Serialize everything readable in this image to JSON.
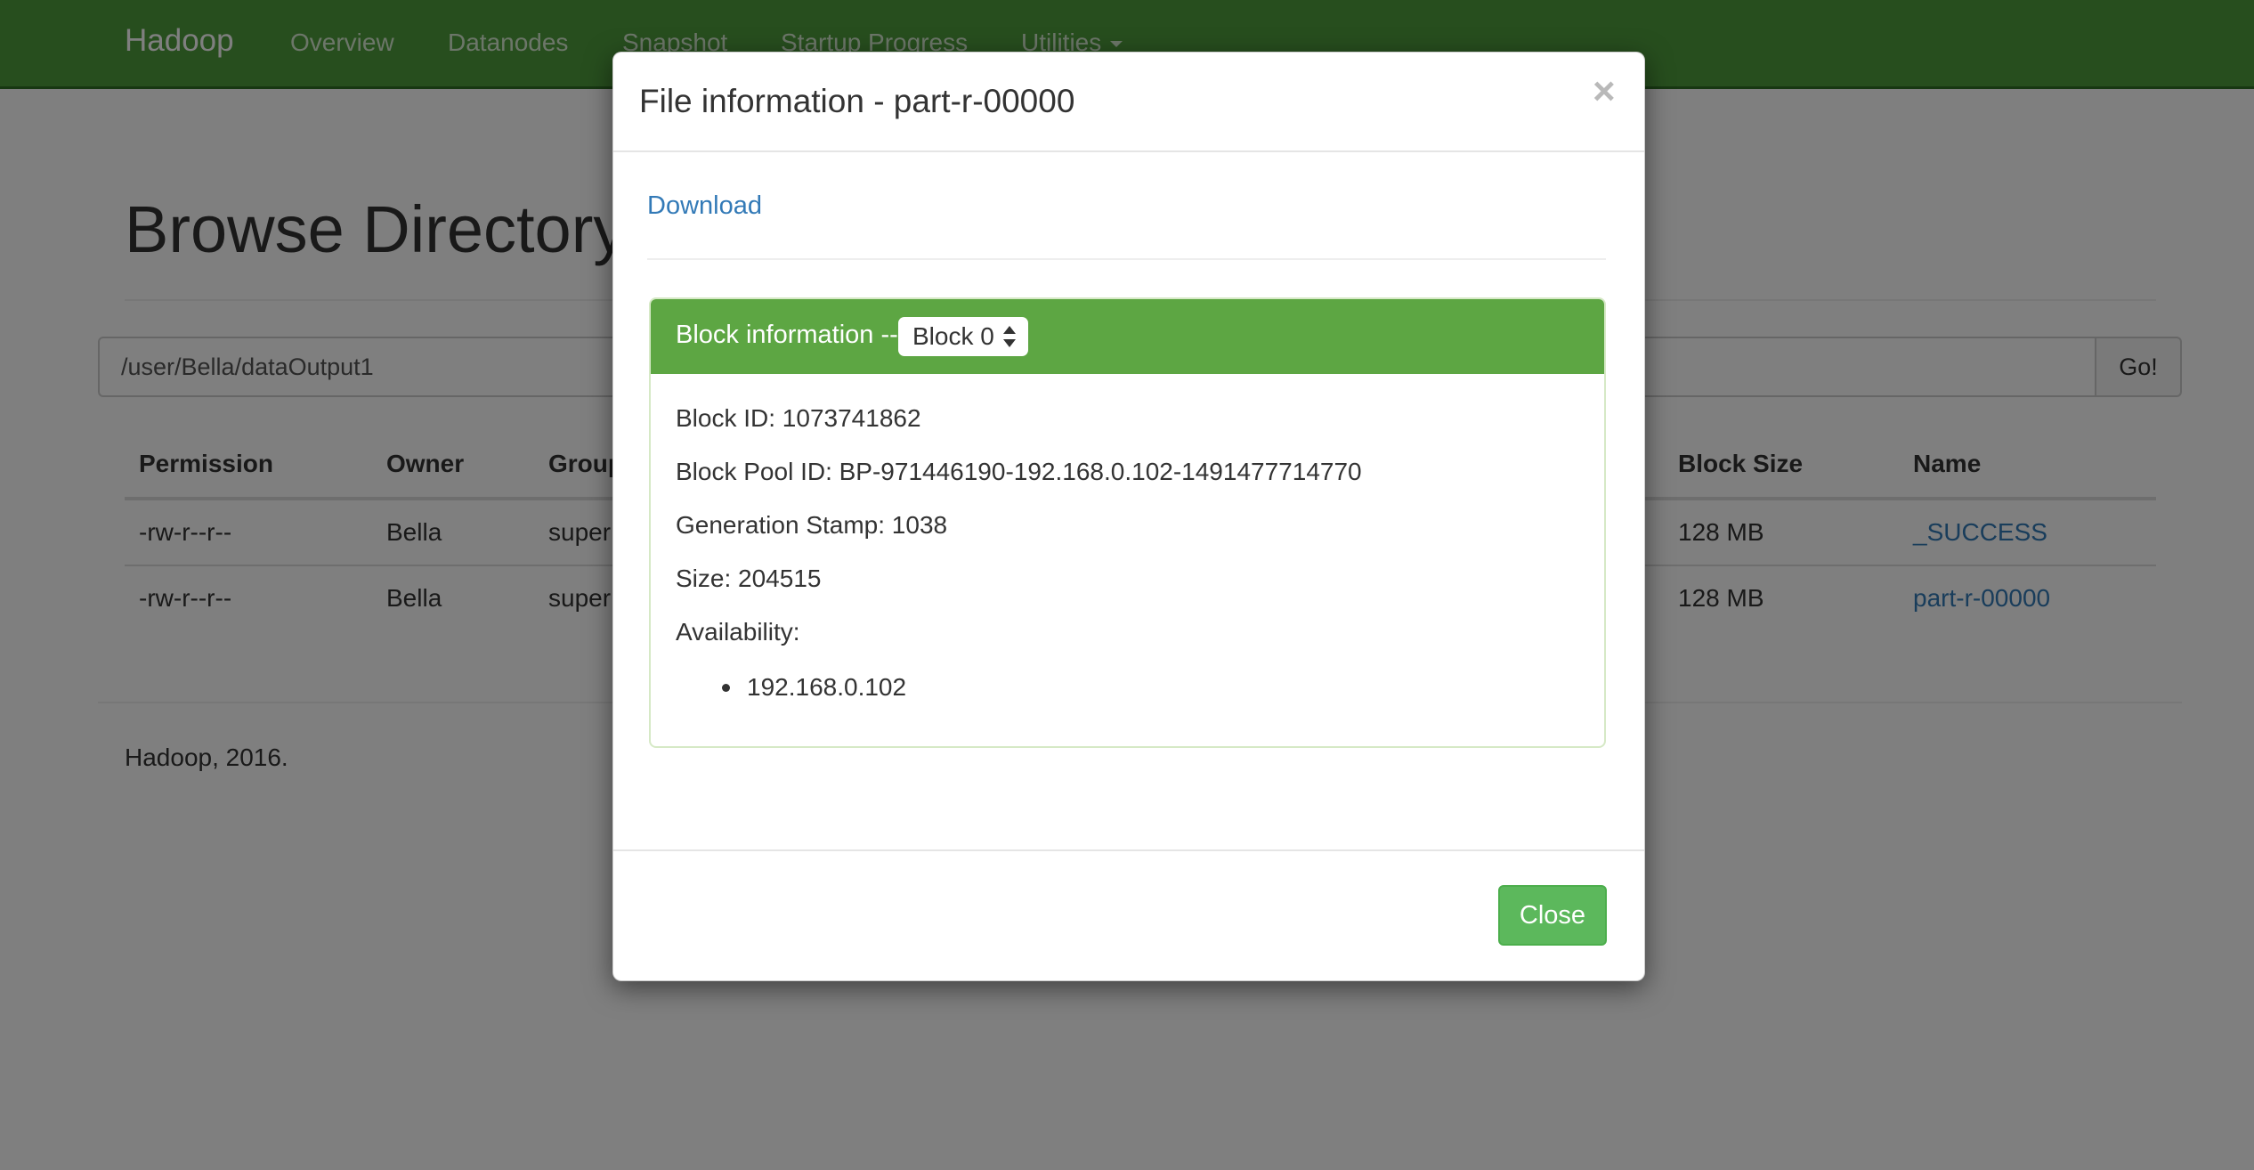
{
  "navbar": {
    "brand": "Hadoop",
    "items": [
      {
        "label": "Overview"
      },
      {
        "label": "Datanodes"
      },
      {
        "label": "Snapshot"
      },
      {
        "label": "Startup Progress"
      },
      {
        "label": "Utilities"
      }
    ]
  },
  "page": {
    "title": "Browse Directory",
    "path_value": "/user/Bella/dataOutput1",
    "go_label": "Go!",
    "footer": "Hadoop, 2016."
  },
  "table": {
    "headers": [
      "Permission",
      "Owner",
      "Group",
      "Block Size",
      "Name"
    ],
    "rows": [
      {
        "permission": "-rw-r--r--",
        "owner": "Bella",
        "group": "super",
        "block_size": "128 MB",
        "name": "_SUCCESS"
      },
      {
        "permission": "-rw-r--r--",
        "owner": "Bella",
        "group": "super",
        "block_size": "128 MB",
        "name": "part-r-00000"
      }
    ]
  },
  "modal": {
    "title": "File information - part-r-00000",
    "close_x": "×",
    "download_label": "Download",
    "panel": {
      "heading": "Block information --",
      "selected_block": "Block 0",
      "block_id": "Block ID: 1073741862",
      "block_pool_id": "Block Pool ID: BP-971446190-192.168.0.102-1491477714770",
      "generation_stamp": "Generation Stamp: 1038",
      "size": "Size: 204515",
      "availability_label": "Availability:",
      "availability": [
        "192.168.0.102"
      ]
    },
    "close_label": "Close"
  },
  "colors": {
    "navbar": "#4f9d3c",
    "panel_heading": "#5da643",
    "link": "#337ab7",
    "close_button": "#5cb85c"
  }
}
